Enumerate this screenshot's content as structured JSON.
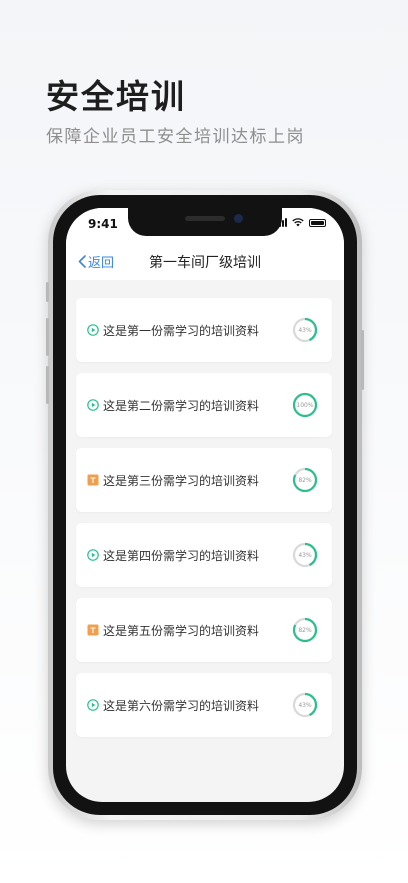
{
  "hero": {
    "title": "安全培训",
    "subtitle": "保障企业员工安全培训达标上岗"
  },
  "status_bar": {
    "time": "9:41"
  },
  "nav": {
    "back_label": "返回",
    "title": "第一车间厂级培训"
  },
  "colors": {
    "accent_blue": "#3b87e0",
    "progress_green": "#2bbf8f",
    "ring_track": "#d9d9d9",
    "doc_orange": "#f0a04b"
  },
  "materials": [
    {
      "label": "这是第一份需学习的培训资料",
      "icon": "play-circle-icon",
      "progress_text": "43%",
      "progress": 43
    },
    {
      "label": "这是第二份需学习的培训资料",
      "icon": "play-circle-icon",
      "progress_text": "100%",
      "progress": 100
    },
    {
      "label": "这是第三份需学习的培训资料",
      "icon": "document-icon",
      "progress_text": "82%",
      "progress": 82
    },
    {
      "label": "这是第四份需学习的培训资料",
      "icon": "play-circle-icon",
      "progress_text": "43%",
      "progress": 43
    },
    {
      "label": "这是第五份需学习的培训资料",
      "icon": "document-icon",
      "progress_text": "82%",
      "progress": 82
    },
    {
      "label": "这是第六份需学习的培训资料",
      "icon": "play-circle-icon",
      "progress_text": "43%",
      "progress": 43
    }
  ]
}
